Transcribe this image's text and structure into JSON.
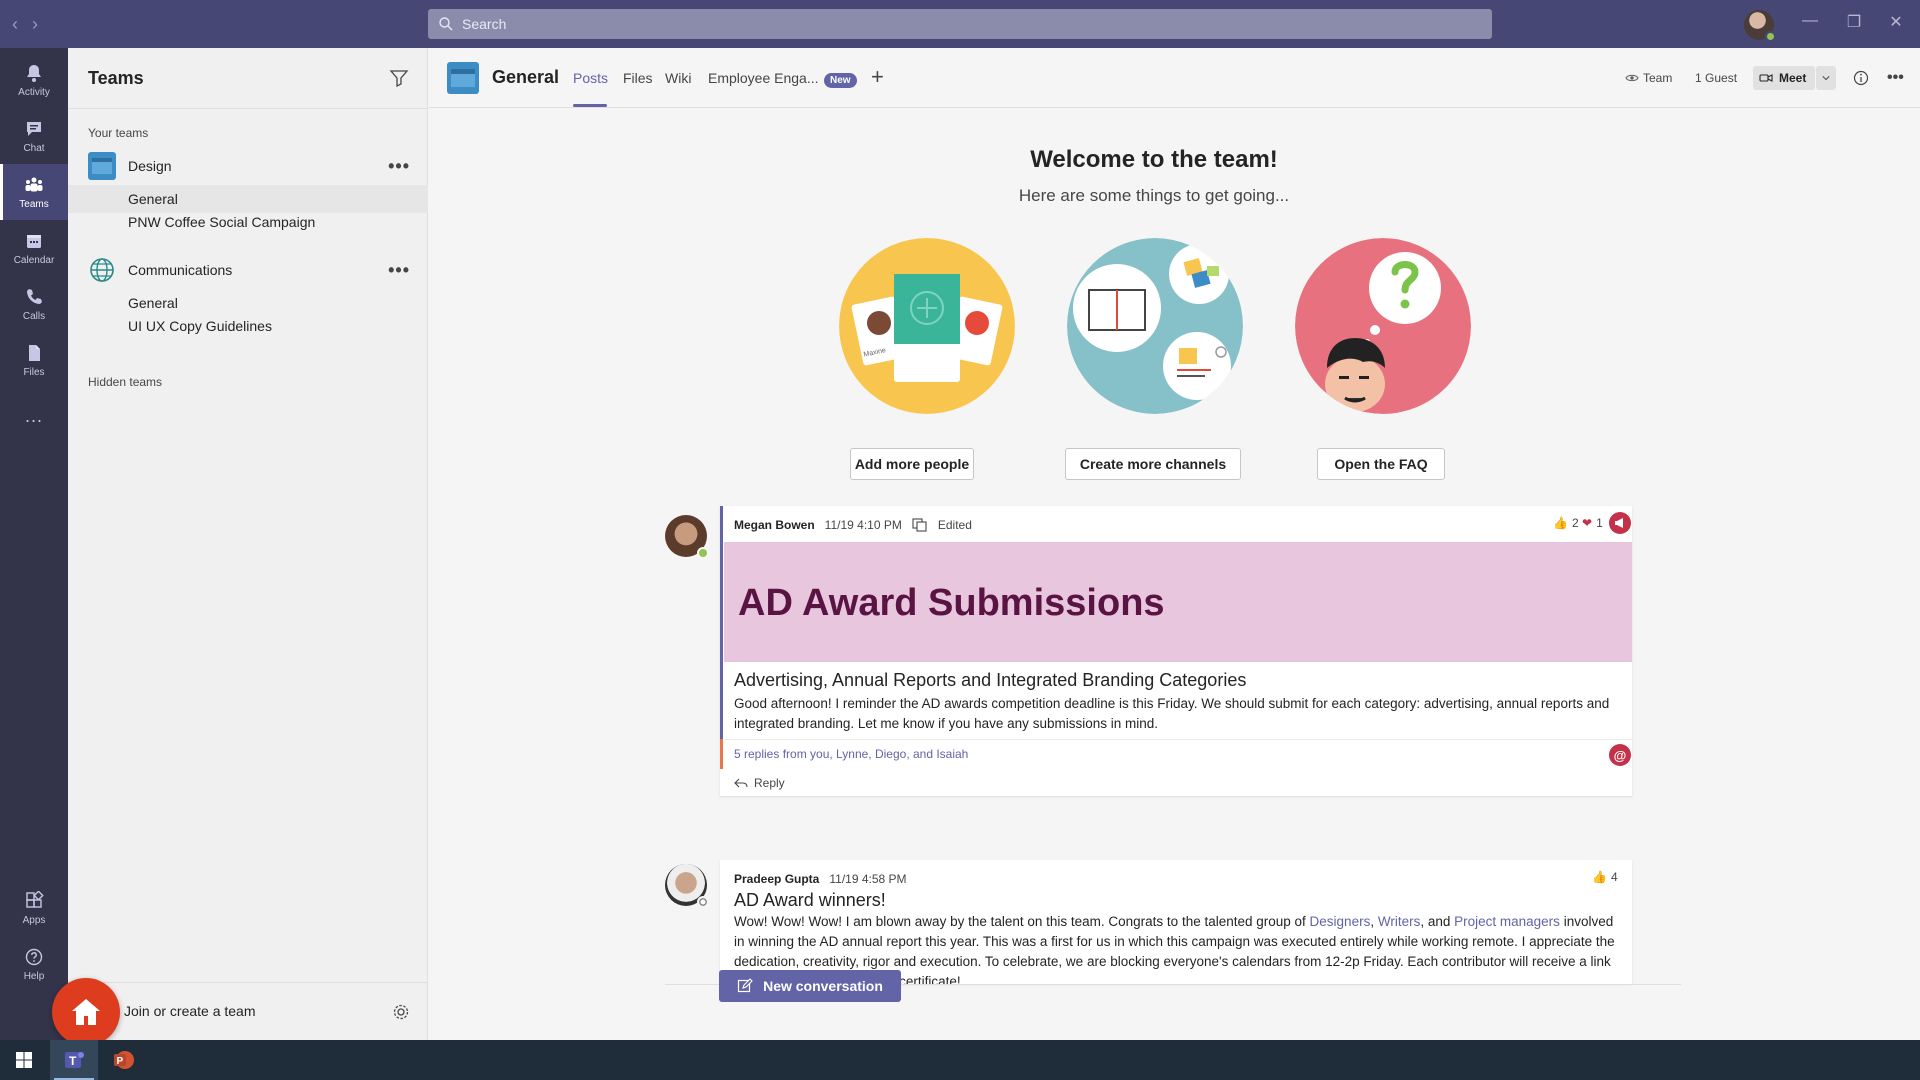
{
  "search": {
    "placeholder": "Search"
  },
  "window_controls": {
    "minimize": "—",
    "restore": "❐",
    "close": "✕"
  },
  "app_bar": {
    "items": [
      {
        "label": "Activity",
        "icon": "bell-icon"
      },
      {
        "label": "Chat",
        "icon": "chat-icon"
      },
      {
        "label": "Teams",
        "icon": "teams-icon",
        "active": true
      },
      {
        "label": "Calendar",
        "icon": "calendar-icon"
      },
      {
        "label": "Calls",
        "icon": "phone-icon"
      },
      {
        "label": "Files",
        "icon": "file-icon"
      }
    ],
    "more": "...",
    "bottom": [
      {
        "label": "Apps",
        "icon": "apps-icon"
      },
      {
        "label": "Help",
        "icon": "help-icon"
      }
    ]
  },
  "teams_panel": {
    "title": "Teams",
    "your_teams_label": "Your teams",
    "teams": [
      {
        "name": "Design",
        "more": "•••",
        "channels": [
          "General",
          "PNW Coffee Social Campaign"
        ],
        "selected_channel": 0
      },
      {
        "name": "Communications",
        "more": "•••",
        "channels": [
          "General",
          "UI UX Copy Guidelines"
        ]
      }
    ],
    "hidden_label": "Hidden teams",
    "join_label": "Join or create a team"
  },
  "channel_header": {
    "title": "General",
    "tabs": [
      "Posts",
      "Files",
      "Wiki",
      "Employee Enga..."
    ],
    "active_tab": "Posts",
    "new_badge": "New",
    "add_tab": "+",
    "team_label": "Team",
    "guest_label": "1 Guest",
    "meet_label": "Meet",
    "more": "•••"
  },
  "welcome": {
    "title": "Welcome to the team!",
    "subtitle": "Here are some things to get going...",
    "actions": [
      "Add more people",
      "Create more channels",
      "Open the FAQ"
    ],
    "illustration_names": [
      "Maxine"
    ]
  },
  "posts": [
    {
      "author": "Megan Bowen",
      "time": "11/19 4:10 PM",
      "edited": "Edited",
      "banner": "AD Award Submissions",
      "subject": "Advertising, Annual Reports and Integrated Branding Categories",
      "body": "Good afternoon! I reminder the AD awards competition deadline is this Friday. We should submit for each category: advertising, annual reports and integrated branding.  Let me know if you have any submissions in mind.",
      "reactions": {
        "like": "2",
        "heart": "1"
      },
      "replies": "5 replies from you, Lynne, Diego, and Isaiah",
      "reply_label": "Reply",
      "status_color": "#92c353"
    },
    {
      "author": "Pradeep Gupta",
      "time": "11/19 4:58 PM",
      "subject": "AD Award winners!",
      "body_start": "Wow! Wow! Wow! I am blown away by the talent on this team. Congrats to the talented group of ",
      "mention_1": "Designers",
      "sep_1": ", ",
      "mention_2": "Writers",
      "sep_2": ", and ",
      "mention_3": "Project managers",
      "body_end": " involved in winning the AD annual report this year. This was a first for us in which this campaign was executed entirely while working remote. I appreciate the dedication, creativity, rigor and execution. To celebrate, we are blocking everyone's calendars from 12-2p Friday. Each contributor will receive a link for lunch delivery and a gift certificate!",
      "reactions": {
        "like": "4"
      }
    }
  ],
  "new_conversation": "New conversation",
  "colors": {
    "brand": "#6264a7",
    "titlebar": "#464775",
    "appbar": "#33344a",
    "home_fab": "#dd3c1f"
  },
  "taskbar": {
    "apps": [
      "windows-start-icon",
      "teams-app-icon",
      "powerpoint-app-icon"
    ],
    "teams_letter": "T",
    "ppt_letter": "P"
  }
}
